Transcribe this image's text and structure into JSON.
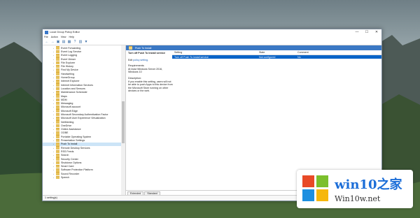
{
  "window": {
    "title": "Local Group Policy Editor",
    "min": "—",
    "max": "☐",
    "close": "✕"
  },
  "menu": [
    "File",
    "Action",
    "View",
    "Help"
  ],
  "tree": {
    "items": [
      "Event Forwarding",
      "Event Log Service",
      "Event Logging",
      "Event Viewer",
      "File Explorer",
      "File History",
      "Find My Device",
      "Handwriting",
      "HomeGroup",
      "Internet Explorer",
      "Internet Information Services",
      "Location and Sensors",
      "Maintenance Scheduler",
      "Maps",
      "MDM",
      "Messaging",
      "Microsoft account",
      "Microsoft Edge",
      "Microsoft Secondary Authentication Factor",
      "Microsoft User Experience Virtualization",
      "NetMeeting",
      "OneDrive",
      "Online Assistance",
      "OOBE",
      "Portable Operating System",
      "Presentation Settings",
      "Push To Install",
      "Remote Desktop Services",
      "RSS Feeds",
      "Search",
      "Security Center",
      "Shutdown Options",
      "Smart Card",
      "Software Protection Platform",
      "Sound Recorder",
      "Speech"
    ],
    "selected": "Push To Install"
  },
  "panel": {
    "header": "Push To Install",
    "policy_title": "Turn off Push To Install service",
    "edit_prefix": "Edit",
    "edit_link": "policy setting.",
    "req_label": "Requirements:",
    "req_text": "At least Windows Server 2016, Windows 10",
    "desc_label": "Description:",
    "desc_text": "If you enable this setting, users will not be able to push Apps to this device from the Microsoft Store running on other devices or the web."
  },
  "grid": {
    "headers": [
      "Setting",
      "State",
      "Comment"
    ],
    "rows": [
      {
        "setting": "Turn off Push To Install service",
        "state": "Not configured",
        "comment": "No"
      }
    ]
  },
  "tabs": [
    "Extended",
    "Standard"
  ],
  "status": "1 setting(s)",
  "watermark": {
    "brand": "win10之家",
    "site": "Win10w.net"
  }
}
